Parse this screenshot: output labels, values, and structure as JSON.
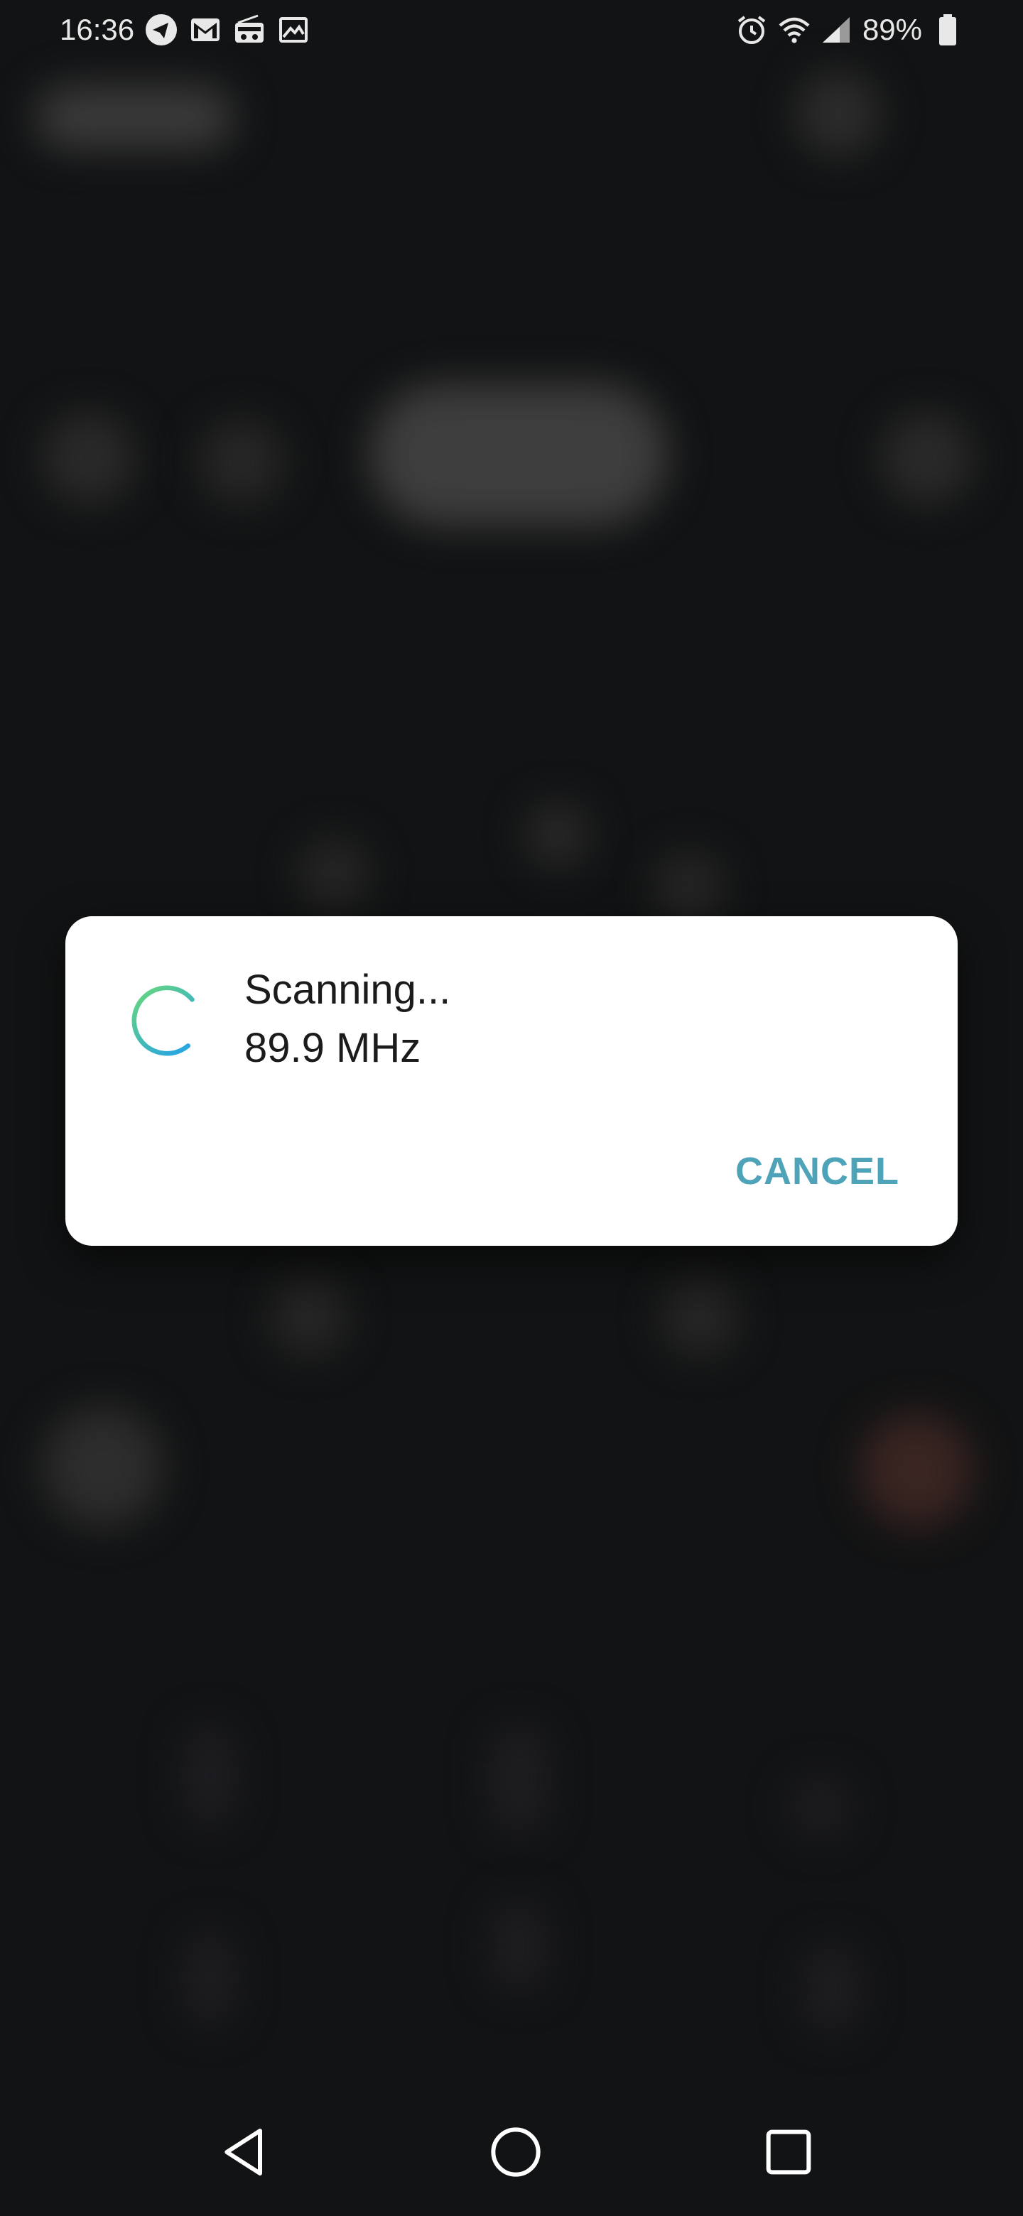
{
  "status_bar": {
    "time": "16:36",
    "battery_percent": "89%",
    "left_icons": [
      "telegram-icon",
      "gmail-icon",
      "radio-icon",
      "gallery-icon"
    ],
    "right_icons": [
      "alarm-icon",
      "wifi-icon",
      "signal-icon",
      "battery-icon"
    ]
  },
  "dialog": {
    "title": "Scanning...",
    "frequency": "89.9 MHz",
    "cancel_label": "CANCEL",
    "accent_color": "#4fa3b8"
  },
  "nav_bar": {
    "buttons": [
      "back-icon",
      "home-icon",
      "recents-icon"
    ]
  }
}
